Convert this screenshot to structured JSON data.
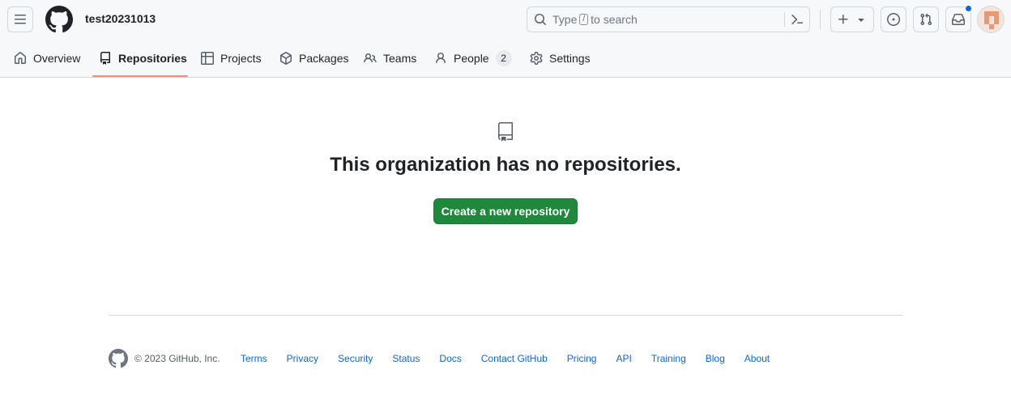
{
  "header": {
    "org_name": "test20231013",
    "search": {
      "text_before": "Type",
      "key": "/",
      "text_after": "to search"
    },
    "icons": [
      "menu-icon",
      "github-logo-icon",
      "search-icon",
      "command-palette-icon",
      "plus-icon",
      "triangle-down-icon",
      "issue-opened-icon",
      "git-pull-request-icon",
      "inbox-icon"
    ],
    "notification_color": "#0969da"
  },
  "tabs": [
    {
      "label": "Overview",
      "icon": "home-icon"
    },
    {
      "label": "Repositories",
      "icon": "repo-icon",
      "active": true
    },
    {
      "label": "Projects",
      "icon": "table-icon"
    },
    {
      "label": "Packages",
      "icon": "package-icon"
    },
    {
      "label": "Teams",
      "icon": "people-icon"
    },
    {
      "label": "People",
      "icon": "person-icon",
      "count": "2"
    },
    {
      "label": "Settings",
      "icon": "gear-icon"
    }
  ],
  "blankslate": {
    "icon": "repo-icon",
    "title": "This organization has no repositories.",
    "button_label": "Create a new repository",
    "button_color": "#1f883d"
  },
  "footer": {
    "copyright": "© 2023 GitHub, Inc.",
    "links": [
      "Terms",
      "Privacy",
      "Security",
      "Status",
      "Docs",
      "Contact GitHub",
      "Pricing",
      "API",
      "Training",
      "Blog",
      "About"
    ]
  },
  "colors": {
    "accent_underline": "#fd8c73",
    "link": "#0969da"
  }
}
